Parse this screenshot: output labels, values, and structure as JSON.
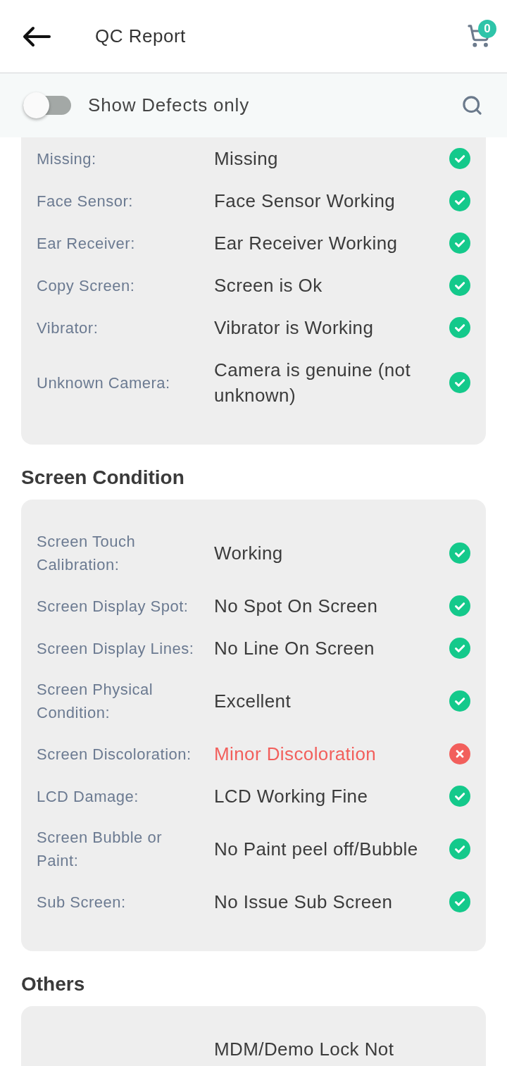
{
  "header": {
    "title": "QC Report",
    "cart_count": "0"
  },
  "filter": {
    "label": "Show Defects only",
    "on": false
  },
  "sections": [
    {
      "rows": [
        {
          "label": "Missing:",
          "value": "Missing",
          "defect": false
        },
        {
          "label": "Face Sensor:",
          "value": "Face Sensor Working",
          "defect": false
        },
        {
          "label": "Ear Receiver:",
          "value": "Ear Receiver Working",
          "defect": false
        },
        {
          "label": "Copy Screen:",
          "value": "Screen is Ok",
          "defect": false
        },
        {
          "label": "Vibrator:",
          "value": "Vibrator is Working",
          "defect": false
        },
        {
          "label": "Unknown Camera:",
          "value": "Camera is genuine (not unknown)",
          "defect": false
        }
      ]
    },
    {
      "title": "Screen Condition",
      "rows": [
        {
          "label": "Screen Touch Calibration:",
          "value": "Working",
          "defect": false
        },
        {
          "label": "Screen Display Spot:",
          "value": "No Spot On Screen",
          "defect": false
        },
        {
          "label": "Screen Display Lines:",
          "value": "No Line On Screen",
          "defect": false
        },
        {
          "label": "Screen Physical Condition:",
          "value": "Excellent",
          "defect": false
        },
        {
          "label": "Screen Discoloration:",
          "value": "Minor Discoloration",
          "defect": true
        },
        {
          "label": "LCD Damage:",
          "value": "LCD Working Fine",
          "defect": false
        },
        {
          "label": "Screen Bubble or Paint:",
          "value": "No Paint peel off/Bubble",
          "defect": false
        },
        {
          "label": "Sub Screen:",
          "value": "No Issue Sub Screen",
          "defect": false
        }
      ]
    },
    {
      "title": "Others",
      "rows": [
        {
          "value": "MDM/Demo Lock Not"
        }
      ]
    }
  ]
}
